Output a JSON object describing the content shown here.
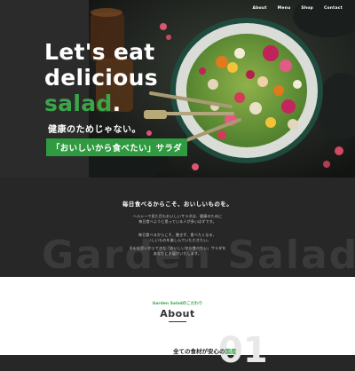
{
  "nav": {
    "items": [
      "About",
      "Menu",
      "Shop",
      "Contact"
    ]
  },
  "hero": {
    "title_line1": "Let's eat",
    "title_line2": "delicious",
    "title_line3": "salad",
    "title_dot": ".",
    "sub1": "健康のためじゃない。",
    "sub2": "「おいしいから食べたい」サラダ"
  },
  "intro": {
    "lead": "毎日食べるからこそ、おいしいものを。",
    "para1_line1": "ヘルシーで見た目もおいしいサラダは、健康のために",
    "para1_line2": "毎日食べようと思っている人が多いはずです。",
    "para2_line1": "毎日食べるからこそ、飽きず、食べたくなる、",
    "para2_line2": "おいしいものを楽しんでいただきたい。",
    "para3_line1": "そんな思いからできた「おいしいから食べたい」サラダを",
    "para3_line2": "あなたにお届けいたします。",
    "bigword": "Garden Salad"
  },
  "about": {
    "small": "Garden Saladのこだわり",
    "title": "About",
    "heading_pre": "全ての食材が安心の",
    "heading_hl": "国産",
    "number": "01"
  },
  "colors": {
    "accent": "#3ba54a",
    "dark_bg": "#272727",
    "light_bg": "#ffffff"
  }
}
